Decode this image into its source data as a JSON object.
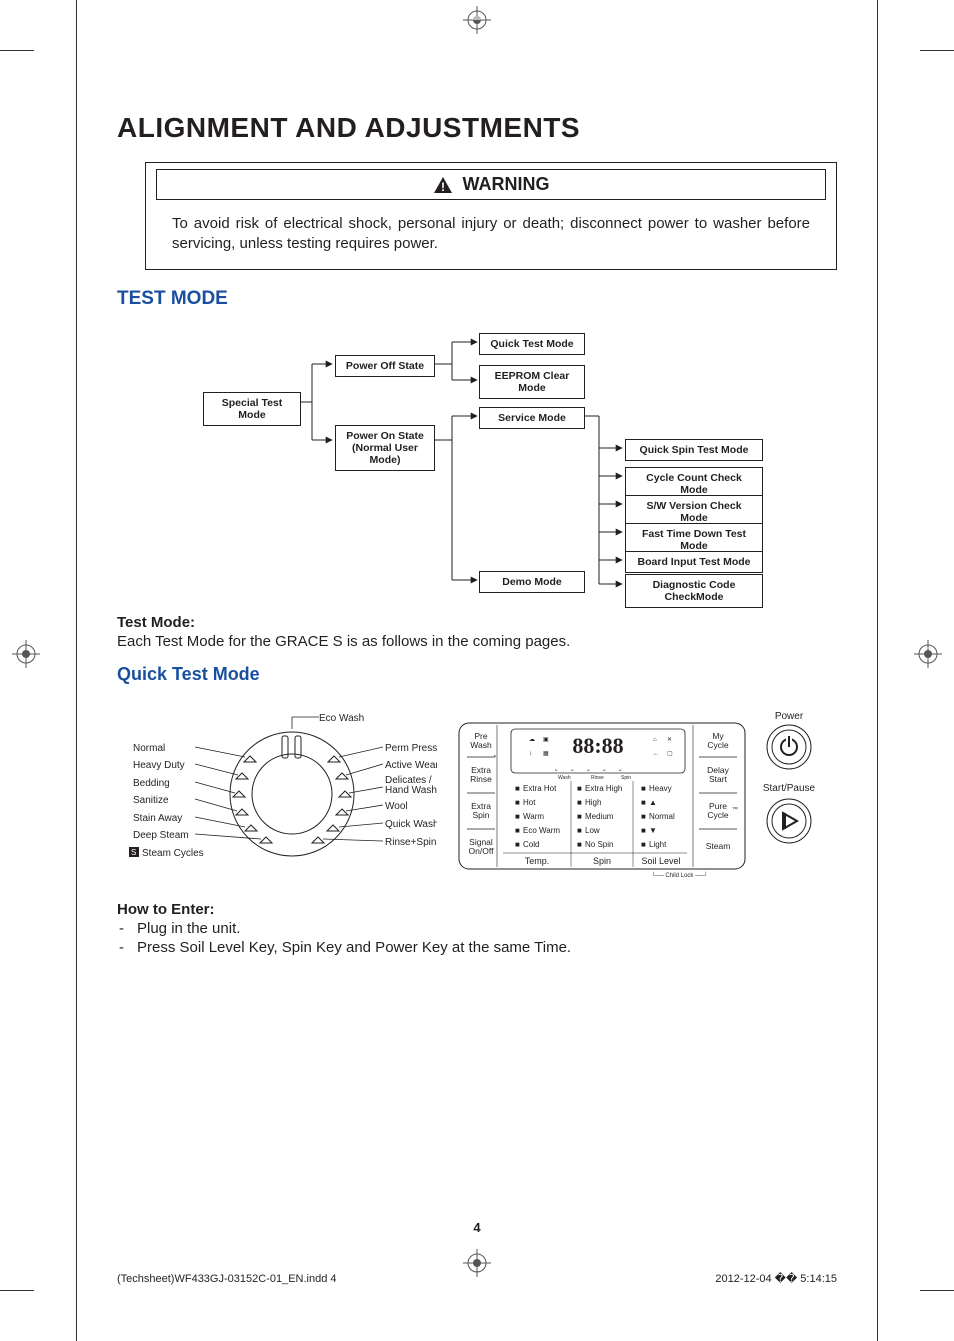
{
  "title": "ALIGNMENT AND ADJUSTMENTS",
  "warning": {
    "label": "WARNING",
    "text": "To avoid risk of electrical shock, personal injury or death; disconnect power to washer before servicing, unless testing requires power."
  },
  "sections": {
    "test_mode": {
      "heading": "TEST MODE",
      "sub_heading": "Test Mode:",
      "sub_text": "Each Test Mode for the GRACE S is as follows in the coming pages."
    },
    "quick_test": {
      "heading": "Quick Test Mode",
      "how_to_enter": "How to Enter:",
      "steps": [
        "Plug in the unit.",
        "Press Soil Level Key, Spin Key and Power Key at the same Time."
      ]
    }
  },
  "diagram": {
    "special": "Special Test Mode",
    "power_off": "Power Off State",
    "power_on_l1": "Power On State",
    "power_on_l2": "(Normal User Mode)",
    "quick_test": "Quick Test Mode",
    "eeprom_l1": "EEPROM Clear",
    "eeprom_l2": "Mode",
    "service": "Service Mode",
    "demo": "Demo Mode",
    "quick_spin": "Quick Spin Test Mode",
    "cycle_count": "Cycle Count Check Mode",
    "sw_version": "S/W Version Check Mode",
    "fast_time": "Fast Time Down Test Mode",
    "board_input": "Board Input Test Mode",
    "diag_l1": "Diagnostic Code",
    "diag_l2": "CheckMode"
  },
  "dial": {
    "left": [
      "Normal",
      "Heavy Duty",
      "Bedding",
      "Sanitize",
      "Stain Away",
      "Deep Steam",
      "Steam Cycles"
    ],
    "right": [
      "Perm Press",
      "Active Wear",
      "Delicates /\nHand Wash",
      "Wool",
      "Quick Wash",
      "Rinse+Spin"
    ],
    "top": "Eco Wash"
  },
  "panel": {
    "left_col": [
      "Pre\nWash",
      "Extra\nRinse",
      "Extra\nSpin",
      "Signal\nOn/Off"
    ],
    "right_col": [
      "My\nCycle",
      "Delay\nStart",
      "Pure\nCycle",
      "Steam"
    ],
    "temp_header": "Temp.",
    "spin_header": "Spin",
    "soil_header": "Soil Level",
    "temps": [
      "Extra Hot",
      "Hot",
      "Warm",
      "Eco Warm",
      "Cold"
    ],
    "spins": [
      "Extra High",
      "High",
      "Medium",
      "Low",
      "No Spin"
    ],
    "soils": [
      "Heavy",
      "▲",
      "Normal",
      "▼",
      "Light"
    ],
    "display": "88:88",
    "child_lock": "Child Lock",
    "power": "Power",
    "start_pause": "Start/Pause"
  },
  "footer": {
    "file": "(Techsheet)WF433GJ-03152C-01_EN.indd   4",
    "date": "2012-12-04   �� 5:14:15",
    "page": "4"
  }
}
